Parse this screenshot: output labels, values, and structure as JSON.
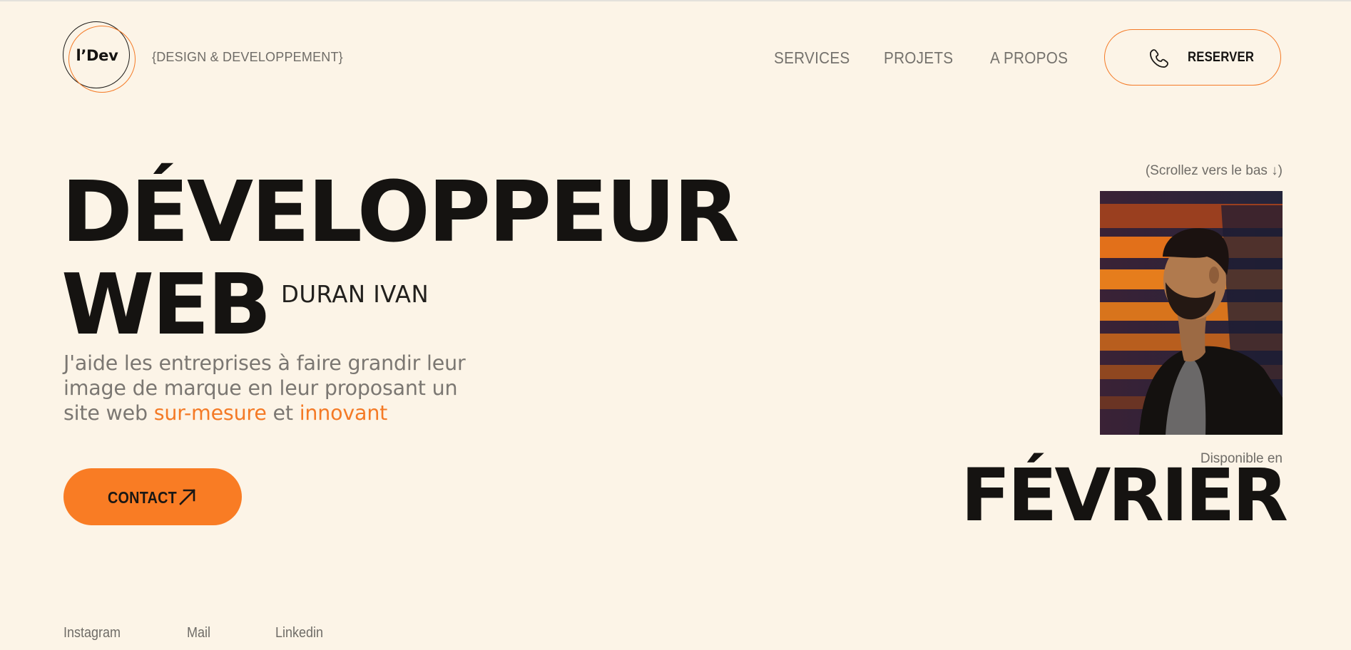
{
  "header": {
    "logo_text": "l’Dev",
    "tagline": "{DESIGN & DEVELOPPEMENT}",
    "nav": [
      {
        "label": "SERVICES"
      },
      {
        "label": "PROJETS"
      },
      {
        "label": "A PROPOS"
      }
    ],
    "reserve_label": "RESERVER"
  },
  "hero": {
    "title_line1": "DÉVELOPPEUR",
    "title_line2": "WEB",
    "name": "DURAN IVAN",
    "intro_part1": "J'aide les entreprises à faire grandir leur image de marque en leur proposant un site web ",
    "intro_highlight1": "sur-mesure",
    "intro_mid": " et ",
    "intro_highlight2": "innovant",
    "contact_label": "CONTACT"
  },
  "aside": {
    "scroll_hint": "(Scrollez vers le bas ↓)",
    "available_label": "Disponible en",
    "available_month": "FÉVRIER"
  },
  "socials": [
    {
      "label": "Instagram"
    },
    {
      "label": "Mail"
    },
    {
      "label": "Linkedin"
    }
  ],
  "colors": {
    "background": "#fcf4e7",
    "accent": "#f97c24",
    "text": "#151311",
    "muted": "#75726d"
  },
  "icons": {
    "phone": "phone-icon",
    "contact_arrow": "arrow-up-right-icon"
  }
}
